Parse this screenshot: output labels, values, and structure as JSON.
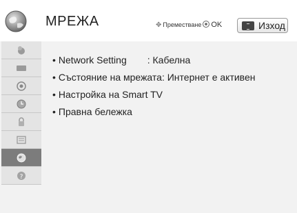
{
  "header": {
    "title": "МРЕЖА",
    "nav_hint": "Преместване",
    "ok_label": "OK",
    "exit_label": "Изход"
  },
  "sidebar": {
    "items": [
      {
        "icon": "picture-icon"
      },
      {
        "icon": "screen-icon"
      },
      {
        "icon": "audio-icon"
      },
      {
        "icon": "time-icon"
      },
      {
        "icon": "lock-icon"
      },
      {
        "icon": "option-icon"
      },
      {
        "icon": "network-icon"
      },
      {
        "icon": "support-icon"
      }
    ],
    "active_index": 6
  },
  "menu": {
    "items": [
      {
        "label": "Network Setting",
        "value": ": Кабелна"
      },
      {
        "label": "Състояние на мрежата: Интернет е активен"
      },
      {
        "label": "Настройка на Smart TV"
      },
      {
        "label": "Правна бележка"
      }
    ]
  },
  "colors": {
    "sidebar_active": "#7c7c7c",
    "panel_bg": "#f2f2f2"
  }
}
